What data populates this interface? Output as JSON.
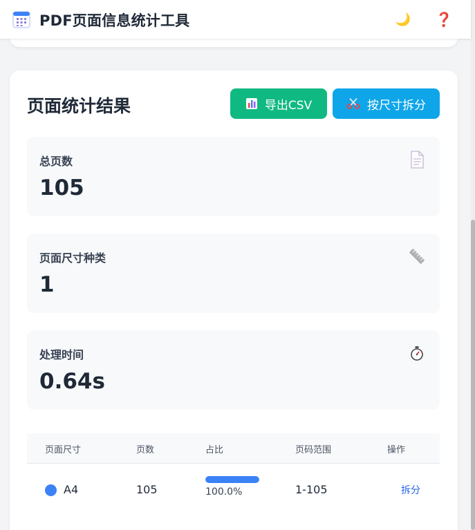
{
  "header": {
    "title": "PDF页面信息统计工具",
    "icons": {
      "app": "calendar-grid-icon",
      "theme": "moon-icon",
      "help": "question-icon"
    },
    "theme_glyph": "🌙",
    "help_glyph": "❓"
  },
  "results": {
    "title": "页面统计结果",
    "export_label": "导出CSV",
    "split_label": "按尺寸拆分",
    "colors": {
      "export": "#10b981",
      "split": "#0ea5e9",
      "accent": "#3b82f6"
    }
  },
  "stats": [
    {
      "label": "总页数",
      "value": "105",
      "icon": "document-icon"
    },
    {
      "label": "页面尺寸种类",
      "value": "1",
      "icon": "ruler-icon"
    },
    {
      "label": "处理时间",
      "value": "0.64s",
      "icon": "stopwatch-icon"
    }
  ],
  "table": {
    "headers": [
      "页面尺寸",
      "页数",
      "占比",
      "页码范围",
      "操作"
    ],
    "rows": [
      {
        "size": "A4",
        "pages": "105",
        "ratio": 1.0,
        "ratio_label": "100.0%",
        "range": "1-105",
        "action": "拆分"
      }
    ]
  }
}
